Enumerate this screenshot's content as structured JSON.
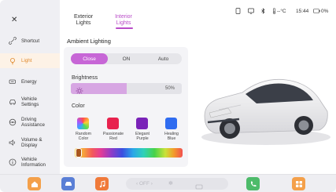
{
  "colors": {
    "accent": "#b94bc8",
    "active_sidebar": "#e08a2e",
    "segment_selected": "#c766d6"
  },
  "sidebar": {
    "close_icon": "close-icon",
    "items": [
      {
        "label": "Shortcut",
        "icon": "shortcut-icon"
      },
      {
        "label": "Light",
        "icon": "light-bulb-icon",
        "active": true
      },
      {
        "label": "Energy",
        "icon": "battery-icon"
      },
      {
        "label": "Vehicle Settings",
        "icon": "car-icon"
      },
      {
        "label": "Driving Assistance",
        "icon": "steering-wheel-icon"
      },
      {
        "label": "Volume & Display",
        "icon": "speaker-icon"
      },
      {
        "label": "Vehicle Information",
        "icon": "info-icon"
      }
    ]
  },
  "tabs": [
    {
      "label": "Exterior Lights"
    },
    {
      "label": "Interior Lights",
      "selected": true
    }
  ],
  "status_bar": {
    "temperature": "--°C",
    "time": "15:44",
    "battery": "0%"
  },
  "ambient": {
    "title": "Ambient Lighting",
    "modes": [
      "Close",
      "ON",
      "Auto"
    ],
    "selected_mode": "Close",
    "brightness_label": "Brightness",
    "brightness_value": "50%",
    "brightness_fraction": 0.5,
    "color_label": "Color",
    "presets": [
      {
        "label": "Random Color"
      },
      {
        "label": "Passionate Red",
        "color": "#e8224e"
      },
      {
        "label": "Elegant Purple",
        "color": "#7a23b8"
      },
      {
        "label": "Healing Blue",
        "color": "#2f6cf0"
      }
    ]
  },
  "dock": {
    "climate_off": "OFF"
  }
}
